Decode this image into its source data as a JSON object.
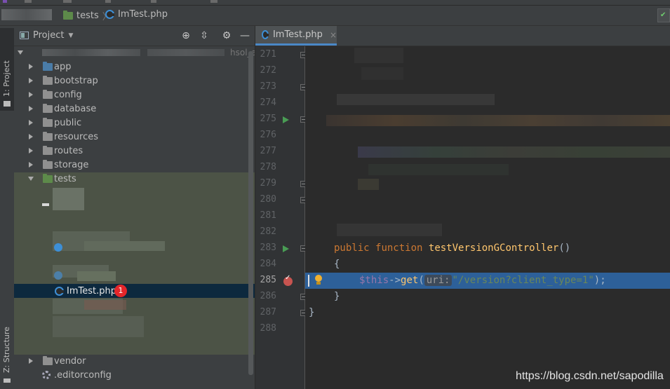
{
  "breadcrumb": {
    "folder": "tests",
    "separator": "〉",
    "file": "ImTest.php"
  },
  "tool_windows": {
    "project": "1: Project",
    "structure": "Z: Structure"
  },
  "project_panel": {
    "title": "Project",
    "dropdown_glyph": "▼",
    "toolbar_icons": [
      "target-icon",
      "collapse-icon",
      "gear-icon",
      "minimize-icon"
    ],
    "hidden_root_suffix": "hsol_a",
    "tree": [
      {
        "label": "app",
        "type": "folder"
      },
      {
        "label": "bootstrap",
        "type": "folder"
      },
      {
        "label": "config",
        "type": "folder"
      },
      {
        "label": "database",
        "type": "folder"
      },
      {
        "label": "public",
        "type": "folder"
      },
      {
        "label": "resources",
        "type": "folder"
      },
      {
        "label": "routes",
        "type": "folder"
      },
      {
        "label": "storage",
        "type": "folder"
      },
      {
        "label": "tests",
        "type": "folder-open"
      }
    ],
    "selected_file": "ImTest.php",
    "selected_badge": "1",
    "bottom_items": [
      {
        "label": "vendor",
        "type": "folder"
      },
      {
        "label": ".editorconfig",
        "type": "gear-file"
      }
    ]
  },
  "editor": {
    "tab_label": "ImTest.php",
    "tab_close": "×",
    "line_numbers": [
      "271",
      "272",
      "273",
      "274",
      "275",
      "276",
      "277",
      "278",
      "279",
      "280",
      "281",
      "282",
      "283",
      "284",
      "285",
      "286",
      "287",
      "288"
    ],
    "current_line": "285",
    "code": {
      "line283": {
        "kw1": "public",
        "kw2": "function",
        "name": "testVersionGController",
        "rest": "()"
      },
      "line284": "{",
      "line285": {
        "var": "$this",
        "arrow": "->",
        "method": "get",
        "open": "(",
        "hint": "uri:",
        "string": "\"/version?client_type=1\"",
        "close": ");"
      },
      "line286": "}",
      "line287": "}"
    }
  },
  "watermark": "https://blog.csdn.net/sapodilla"
}
